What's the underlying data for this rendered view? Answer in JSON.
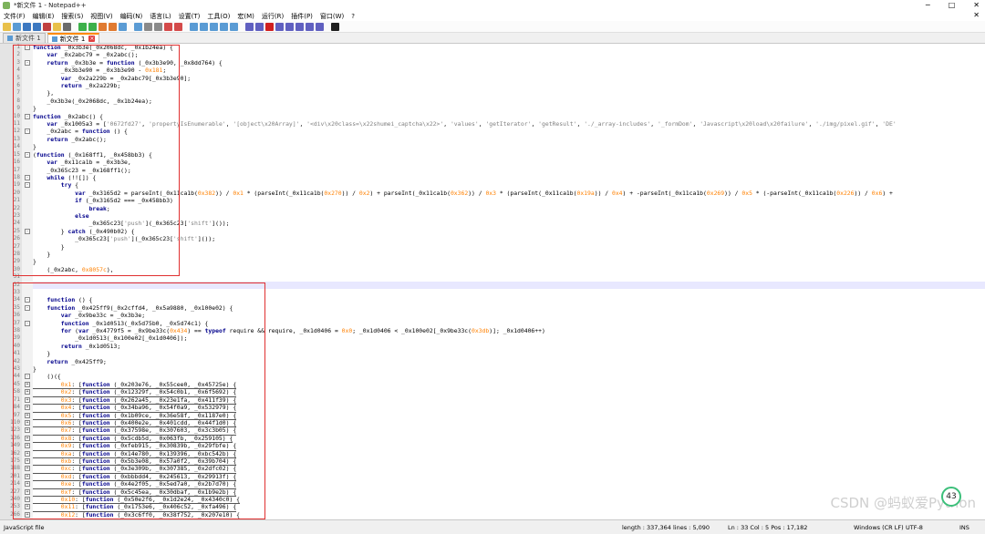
{
  "window": {
    "title": "*新文件 1 - Notepad++",
    "minimize": "─",
    "maximize": "□",
    "close": "✕"
  },
  "menu": [
    "文件(F)",
    "编辑(E)",
    "搜索(S)",
    "视图(V)",
    "编码(N)",
    "语言(L)",
    "设置(T)",
    "工具(O)",
    "宏(M)",
    "运行(R)",
    "插件(P)",
    "窗口(W)",
    "?"
  ],
  "menu_close": "✕",
  "toolbar_colors": [
    "#e8c04a",
    "#5a9bd4",
    "#3c78c0",
    "#3c78c0",
    "#c04040",
    "#e8c04a",
    "#6a6a6a",
    "#3cb04a",
    "#3cb04a",
    "#e07a30",
    "#e07a30",
    "#5a9bd4",
    "#5a9bd4",
    "#8a8a8a",
    "#8a8a8a",
    "#d44a4a",
    "#d44a4a",
    "#5a9bd4",
    "#5a9bd4",
    "#5a9bd4",
    "#5a9bd4",
    "#5a9bd4",
    "#6060c0",
    "#6060c0",
    "#d02020",
    "#6060c0",
    "#6060c0",
    "#6060c0",
    "#6060c0",
    "#6060c0",
    "#202020"
  ],
  "tabs": [
    {
      "label": "新文件 1"
    },
    {
      "label": "新文件 1"
    }
  ],
  "tab_close": "×",
  "lines": [
    {
      "n": "1",
      "f": "-",
      "t": "function _0x3b3e(_0x2068dc, _0x1b24ea) {"
    },
    {
      "n": "2",
      "t": "    var _0x2abc79 = _0x2abc();"
    },
    {
      "n": "3",
      "f": "-",
      "t": "    return _0x3b3e = function (_0x3b3e90, _0x8dd764) {"
    },
    {
      "n": "4",
      "t": "        _0x3b3e90 = _0x3b3e90 - 0x181;"
    },
    {
      "n": "5",
      "t": "        var _0x2a229b = _0x2abc79[_0x3b3e90];"
    },
    {
      "n": "6",
      "t": "        return _0x2a229b;"
    },
    {
      "n": "7",
      "t": "    },"
    },
    {
      "n": "8",
      "t": "    _0x3b3e(_0x2068dc, _0x1b24ea);"
    },
    {
      "n": "9",
      "t": "}"
    },
    {
      "n": "10",
      "f": "-",
      "t": "function _0x2abc() {"
    },
    {
      "n": "11",
      "t": "    var _0x1005a3 = ['0672fd27', 'propertyIsEnumerable', '[object\\x20Array]', '<div\\x20class=\\x22shumei_captcha\\x22>', 'values', 'getIterator', 'getResult', './_array-includes', '_formDom', 'Javascript\\x20load\\x20failure', './img/pixel.gif', 'DE'"
    },
    {
      "n": "12",
      "f": "-",
      "t": "    _0x2abc = function () {"
    },
    {
      "n": "13",
      "t": "    return _0x2abc();"
    },
    {
      "n": "14",
      "t": "}"
    },
    {
      "n": "15",
      "f": "-",
      "t": "(function (_0x168ff1, _0x458bb3) {"
    },
    {
      "n": "16",
      "t": "    var _0x11ca1b = _0x3b3e,"
    },
    {
      "n": "17",
      "t": "    _0x365c23 = _0x168ff1();"
    },
    {
      "n": "18",
      "f": "-",
      "t": "    while (!![]) {"
    },
    {
      "n": "19",
      "f": "-",
      "t": "        try {"
    },
    {
      "n": "20",
      "t": "            var _0x3165d2 = parseInt(_0x11ca1b(0x382)) / 0x1 * (parseInt(_0x11ca1b(0x270)) / 0x2) + parseInt(_0x11ca1b(0x362)) / 0x3 * (parseInt(_0x11ca1b(0x19a)) / 0x4) + -parseInt(_0x11ca1b(0x269)) / 0x5 * (-parseInt(_0x11ca1b(0x226)) / 0x6) +"
    },
    {
      "n": "21",
      "t": "            if (_0x3165d2 === _0x458bb3)"
    },
    {
      "n": "22",
      "t": "                break;"
    },
    {
      "n": "23",
      "t": "            else"
    },
    {
      "n": "24",
      "t": "                _0x365c23['push'](_0x365c23['shift']());"
    },
    {
      "n": "25",
      "f": "-",
      "t": "        } catch (_0x490b02) {"
    },
    {
      "n": "26",
      "t": "            _0x365c23['push'](_0x365c23['shift']());"
    },
    {
      "n": "27",
      "t": "        }"
    },
    {
      "n": "28",
      "t": "    }"
    },
    {
      "n": "29",
      "t": "}"
    },
    {
      "n": "30",
      "t": "    (_0x2abc, 0x8057c),"
    },
    {
      "n": "31",
      "t": ""
    },
    {
      "n": "32",
      "t": "",
      "hl": true
    },
    {
      "n": "33",
      "t": ""
    },
    {
      "n": "34",
      "f": "-",
      "t": "    function () {"
    },
    {
      "n": "35",
      "f": "-",
      "t": "    function _0x425ff9(_0x2cffd4, _0x5a9880, _0x100e02) {"
    },
    {
      "n": "36",
      "t": "        var _0x9be33c = _0x3b3e;"
    },
    {
      "n": "37",
      "f": "-",
      "t": "        function _0x1d0513(_0x5d75b0, _0x5d74c1) {"
    },
    {
      "n": "38",
      "t": "        for (var _0x4779f5 = _0x9be33c(0x434) == typeof require && require, _0x1d0406 = 0x0; _0x1d0406 < _0x100e02[_0x9be33c(0x3db)]; _0x1d0406++)"
    },
    {
      "n": "39",
      "t": "            _0x1d0513(_0x100e02[_0x1d0406]);"
    },
    {
      "n": "40",
      "t": "        return _0x1d0513;"
    },
    {
      "n": "41",
      "t": "    }"
    },
    {
      "n": "42",
      "t": "    return _0x425ff9;"
    },
    {
      "n": "43",
      "t": "}"
    },
    {
      "n": "44",
      "f": "-",
      "t": "    ()({"
    },
    {
      "n": "45",
      "f": "+",
      "u": true,
      "t": "        0x1: [function (_0x203e76, _0x55cee0, _0x45725e) {"
    },
    {
      "n": "58",
      "f": "+",
      "u": true,
      "t": "        0x2: [function (_0x12329f, _0x54c0b1, _0x6f5692) {"
    },
    {
      "n": "71",
      "f": "+",
      "u": true,
      "t": "        0x3: [function (_0x262a45, _0x23e1fa, _0x411f39) {"
    },
    {
      "n": "84",
      "f": "+",
      "u": true,
      "t": "        0x4: [function (_0x34ba96, _0x54f0a9, _0x532979) {"
    },
    {
      "n": "97",
      "f": "+",
      "u": true,
      "t": "        0x5: [function (_0x1b09ce, _0x36e58f, _0x1187e0) {"
    },
    {
      "n": "110",
      "f": "+",
      "u": true,
      "t": "        0x6: [function (_0x400e2e, _0x401cdd, _0x44f1d0) {"
    },
    {
      "n": "123",
      "f": "+",
      "u": true,
      "t": "        0x7: [function (_0x37598e, _0x307603, _0x3c3b05) {"
    },
    {
      "n": "136",
      "f": "+",
      "u": true,
      "t": "        0x8: [function (_0x5cdb5d, _0x063fb, _0x259105) {"
    },
    {
      "n": "149",
      "f": "+",
      "u": true,
      "t": "        0x9: [function (_0xfeb915, _0x30839b, _0x29fbfe) {"
    },
    {
      "n": "162",
      "f": "+",
      "u": true,
      "t": "        0xa: [function (_0x14e780, _0x139396, _0xbc542b) {"
    },
    {
      "n": "175",
      "f": "+",
      "u": true,
      "t": "        0xb: [function (_0x5b3e08, _0x57a0f2, _0x39b704) {"
    },
    {
      "n": "188",
      "f": "+",
      "u": true,
      "t": "        0xc: [function (_0x3e309b, _0x307385, _0x2dfc02) {"
    },
    {
      "n": "201",
      "f": "+",
      "u": true,
      "t": "        0xd: [function (_0xbbbdd4, _0x245613, _0x29913f) {"
    },
    {
      "n": "214",
      "f": "+",
      "u": true,
      "t": "        0xe: [function (_0x4e2f05, _0x5ed7a0, _0x2b7d70) {"
    },
    {
      "n": "227",
      "f": "+",
      "u": true,
      "t": "        0xf: [function (_0x5c45ea, _0x30dbaf, _0x1b9e2b) {"
    },
    {
      "n": "240",
      "f": "+",
      "u": true,
      "t": "        0x10: [function (_0x50e2f6, _0x1d2e24, _0x4340c0) {"
    },
    {
      "n": "253",
      "f": "+",
      "u": true,
      "t": "        0x11: [function (_0x1753e6, _0x406c52, _0xfa496) {"
    },
    {
      "n": "266",
      "f": "+",
      "u": true,
      "t": "        0x12: [function (_0x3c6ff0, _0x38f752, _0x207e10) {"
    }
  ],
  "status": {
    "language": "JavaScript file",
    "length": "length : 337,364",
    "lines": "lines : 5,090",
    "position": "Ln : 33    Col : 5    Pos : 17,182",
    "eol": "Windows (CR LF)",
    "encoding": "UTF-8",
    "mode": "INS"
  },
  "watermark": "CSDN @蚂蚁爱Python",
  "badge": "43"
}
